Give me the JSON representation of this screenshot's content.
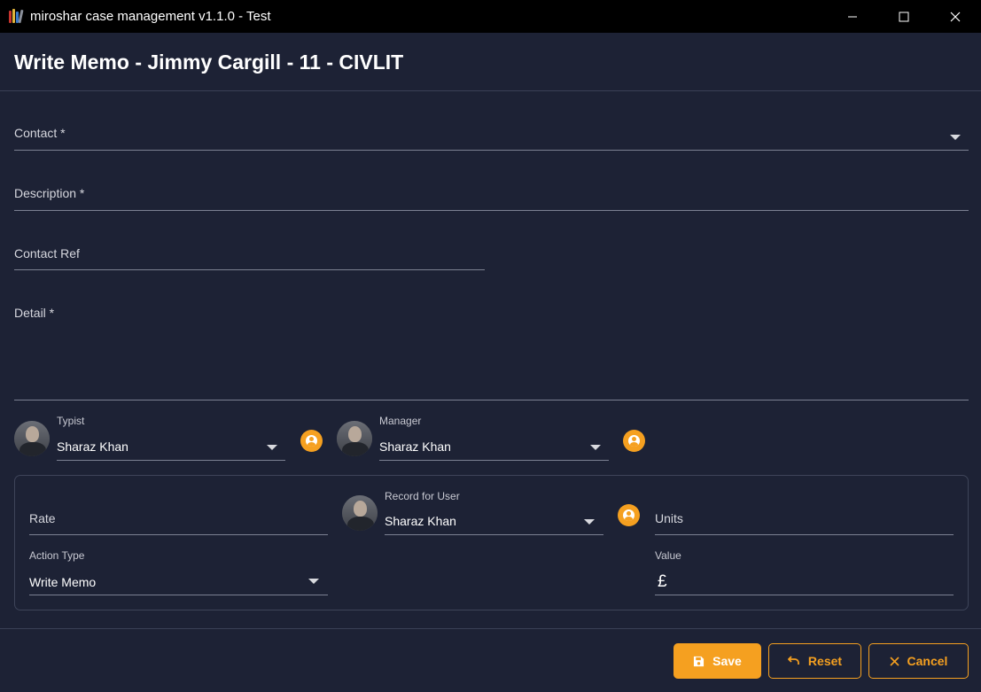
{
  "window": {
    "title": "miroshar case management v1.1.0 - Test"
  },
  "page": {
    "title": "Write Memo - Jimmy Cargill - 11 - CIVLIT"
  },
  "form": {
    "contact": {
      "label": "Contact *",
      "value": ""
    },
    "description": {
      "label": "Description *",
      "value": ""
    },
    "contact_ref": {
      "label": "Contact Ref",
      "value": ""
    },
    "detail": {
      "label": "Detail *",
      "value": ""
    },
    "typist": {
      "label": "Typist",
      "value": "Sharaz Khan"
    },
    "manager": {
      "label": "Manager",
      "value": "Sharaz Khan"
    }
  },
  "panel": {
    "rate": {
      "label": "Rate",
      "value": ""
    },
    "record_for_user": {
      "label": "Record for User",
      "value": "Sharaz Khan"
    },
    "units": {
      "label": "Units",
      "value": ""
    },
    "action_type": {
      "label": "Action Type",
      "value": "Write Memo"
    },
    "value": {
      "label": "Value",
      "currency": "£",
      "value": ""
    }
  },
  "buttons": {
    "save": "Save",
    "reset": "Reset",
    "cancel": "Cancel"
  },
  "colors": {
    "background": "#1d2235",
    "accent": "#f5a020",
    "titlebar": "#000000"
  },
  "icons": {
    "app": "books-icon",
    "minimize": "minimize-icon",
    "maximize": "maximize-icon",
    "close": "close-icon",
    "dropdown": "chevron-down-icon",
    "user": "user-circle-icon",
    "save": "floppy-disk-icon",
    "reset": "undo-icon",
    "cancel": "x-icon"
  }
}
